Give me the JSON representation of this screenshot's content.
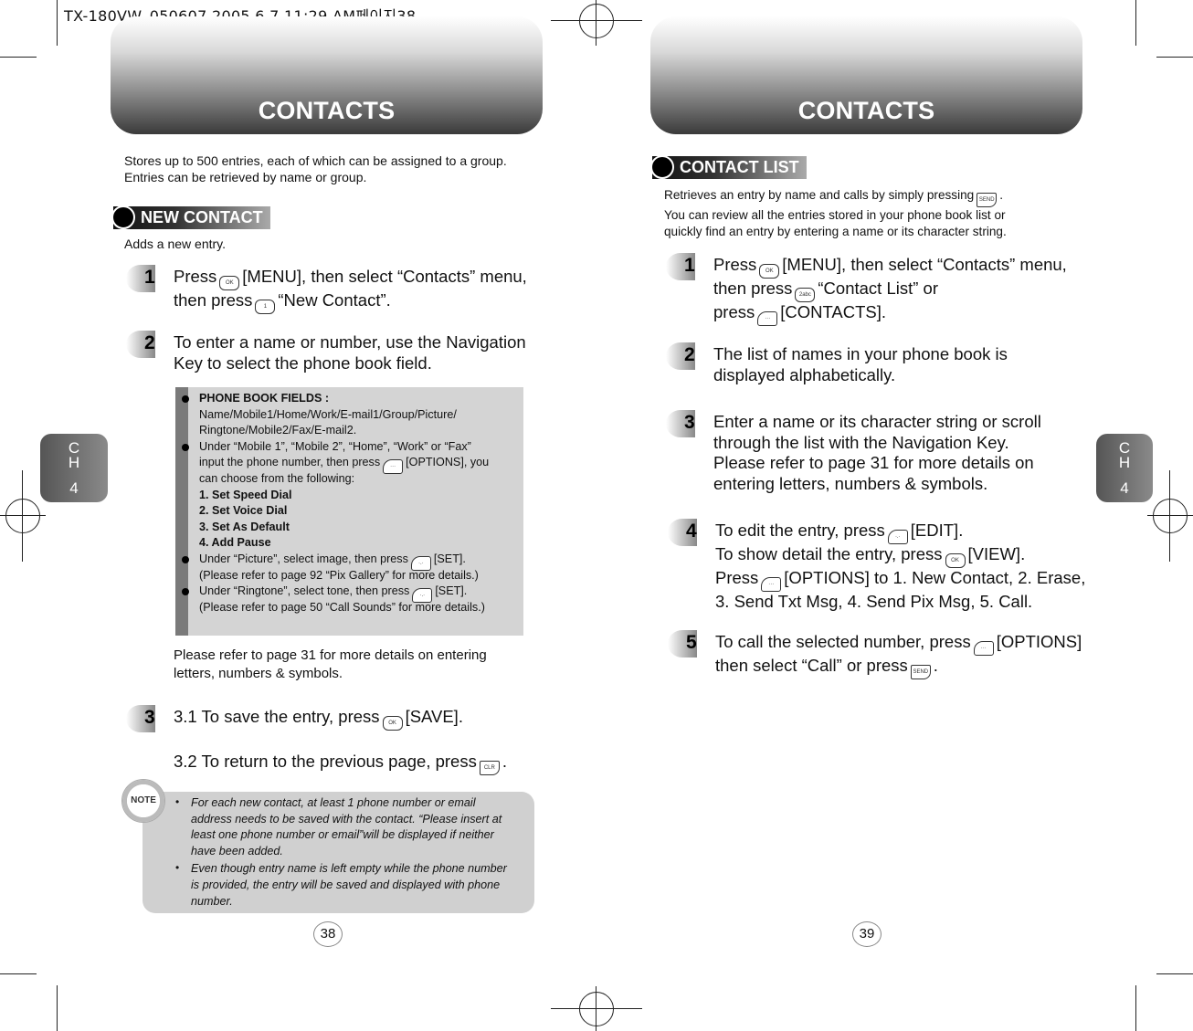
{
  "slug": "TX-180VW_050607  2005.6.7 11:29 AM페이지38",
  "left": {
    "header": "CONTACTS",
    "chapter": [
      "C",
      "H",
      "4"
    ],
    "intro": [
      "Stores up to 500 entries, each of which can be assigned to a group.",
      "Entries can be retrieved by name or group."
    ],
    "section": "NEW CONTACT",
    "section_desc": "Adds a new entry.",
    "steps": [
      {
        "num": "1",
        "lines": [
          [
            "Press",
            {
              "key": "ok"
            },
            "[MENU], then select “Contacts” menu,"
          ],
          [
            "then press",
            {
              "key": "1"
            },
            "“New Contact”."
          ]
        ]
      },
      {
        "num": "2",
        "lines": [
          [
            "To enter a name or number, use the Navigation"
          ],
          [
            "Key to select the phone book field."
          ]
        ]
      },
      {
        "num": "3",
        "lines": [
          [
            "3.1 To save the entry, press",
            {
              "key": "ok"
            },
            "[SAVE]."
          ],
          [
            ""
          ],
          [
            "3.2 To return to the previous page, press",
            {
              "key": "clr"
            },
            "."
          ]
        ]
      }
    ],
    "fields_box": [
      {
        "bullet": true,
        "bold": true,
        "t": [
          "PHONE BOOK FIELDS :"
        ]
      },
      {
        "t": [
          "Name/Mobile1/Home/Work/E-mail1/Group/Picture/"
        ]
      },
      {
        "t": [
          "Ringtone/Mobile2/Fax/E-mail2."
        ]
      },
      {
        "bullet": true,
        "t": [
          "Under “Mobile 1”, “Mobile 2”, “Home”, “Work” or “Fax”"
        ]
      },
      {
        "t": [
          "input the phone number, then press",
          {
            "key": "menu"
          },
          "[OPTIONS], you"
        ]
      },
      {
        "t": [
          "can choose from the following:"
        ]
      },
      {
        "bold": true,
        "t": [
          "1. Set Speed Dial"
        ]
      },
      {
        "bold": true,
        "t": [
          "2. Set Voice Dial"
        ]
      },
      {
        "bold": true,
        "t": [
          "3. Set As Default"
        ]
      },
      {
        "bold": true,
        "t": [
          "4. Add Pause"
        ]
      },
      {
        "bullet": true,
        "t": [
          "Under “Picture”, select image, then press",
          {
            "key": "soft"
          },
          "[SET]."
        ]
      },
      {
        "t": [
          "(Please refer to page 92 “Pix Gallery” for more details.)"
        ]
      },
      {
        "bullet": true,
        "t": [
          "Under “Ringtone”, select tone, then press",
          {
            "key": "soft"
          },
          "[SET]."
        ]
      },
      {
        "t": [
          "(Please refer to page 50 “Call Sounds” for more details.)"
        ]
      }
    ],
    "refer": [
      "Please refer to page 31 for more details on entering",
      "letters, numbers & symbols."
    ],
    "note_label": "NOTE",
    "note": [
      [
        "For each new contact, at least 1 phone number or email",
        "address needs to be saved with the contact. “Please insert at",
        "least one phone number or email”will be displayed if neither",
        "have been added."
      ],
      [
        "Even though entry name is left empty while the phone number",
        "is provided, the entry will be saved and displayed with phone",
        "number."
      ]
    ],
    "page": "38"
  },
  "right": {
    "header": "CONTACTS",
    "chapter": [
      "C",
      "H",
      "4"
    ],
    "section": "CONTACT LIST",
    "intro": [
      [
        "Retrieves an entry by name and calls by simply pressing",
        {
          "key": "send"
        },
        "."
      ],
      [
        "You can review all the entries stored in your phone book list or"
      ],
      [
        "quickly find an entry by entering a name or its character string."
      ]
    ],
    "steps": [
      {
        "num": "1",
        "lines": [
          [
            "Press",
            {
              "key": "ok"
            },
            "[MENU], then select “Contacts” menu,"
          ],
          [
            "then press",
            {
              "key": "2abc"
            },
            "“Contact List” or"
          ],
          [
            "press",
            {
              "key": "menu"
            },
            "[CONTACTS]."
          ]
        ]
      },
      {
        "num": "2",
        "lines": [
          [
            "The list of names in your phone book is"
          ],
          [
            "displayed alphabetically."
          ]
        ]
      },
      {
        "num": "3",
        "lines": [
          [
            "Enter a name or its character string or scroll"
          ],
          [
            "through the list with the Navigation Key."
          ],
          [
            "Please refer to page 31 for more details on"
          ],
          [
            "entering letters, numbers & symbols."
          ]
        ]
      },
      {
        "num": "4",
        "lines": [
          [
            "To edit the entry, press",
            {
              "key": "soft"
            },
            "[EDIT]."
          ],
          [
            "To show detail the entry, press",
            {
              "key": "ok"
            },
            "[VIEW]."
          ],
          [
            "Press",
            {
              "key": "menu"
            },
            "[OPTIONS] to 1. New Contact, 2. Erase,"
          ],
          [
            "3. Send Txt Msg, 4. Send Pix Msg, 5. Call."
          ]
        ]
      },
      {
        "num": "5",
        "lines": [
          [
            "To call the selected number, press",
            {
              "key": "menu"
            },
            "[OPTIONS]"
          ],
          [
            "then select “Call” or press",
            {
              "key": "send"
            },
            "."
          ]
        ]
      }
    ],
    "page": "39"
  }
}
